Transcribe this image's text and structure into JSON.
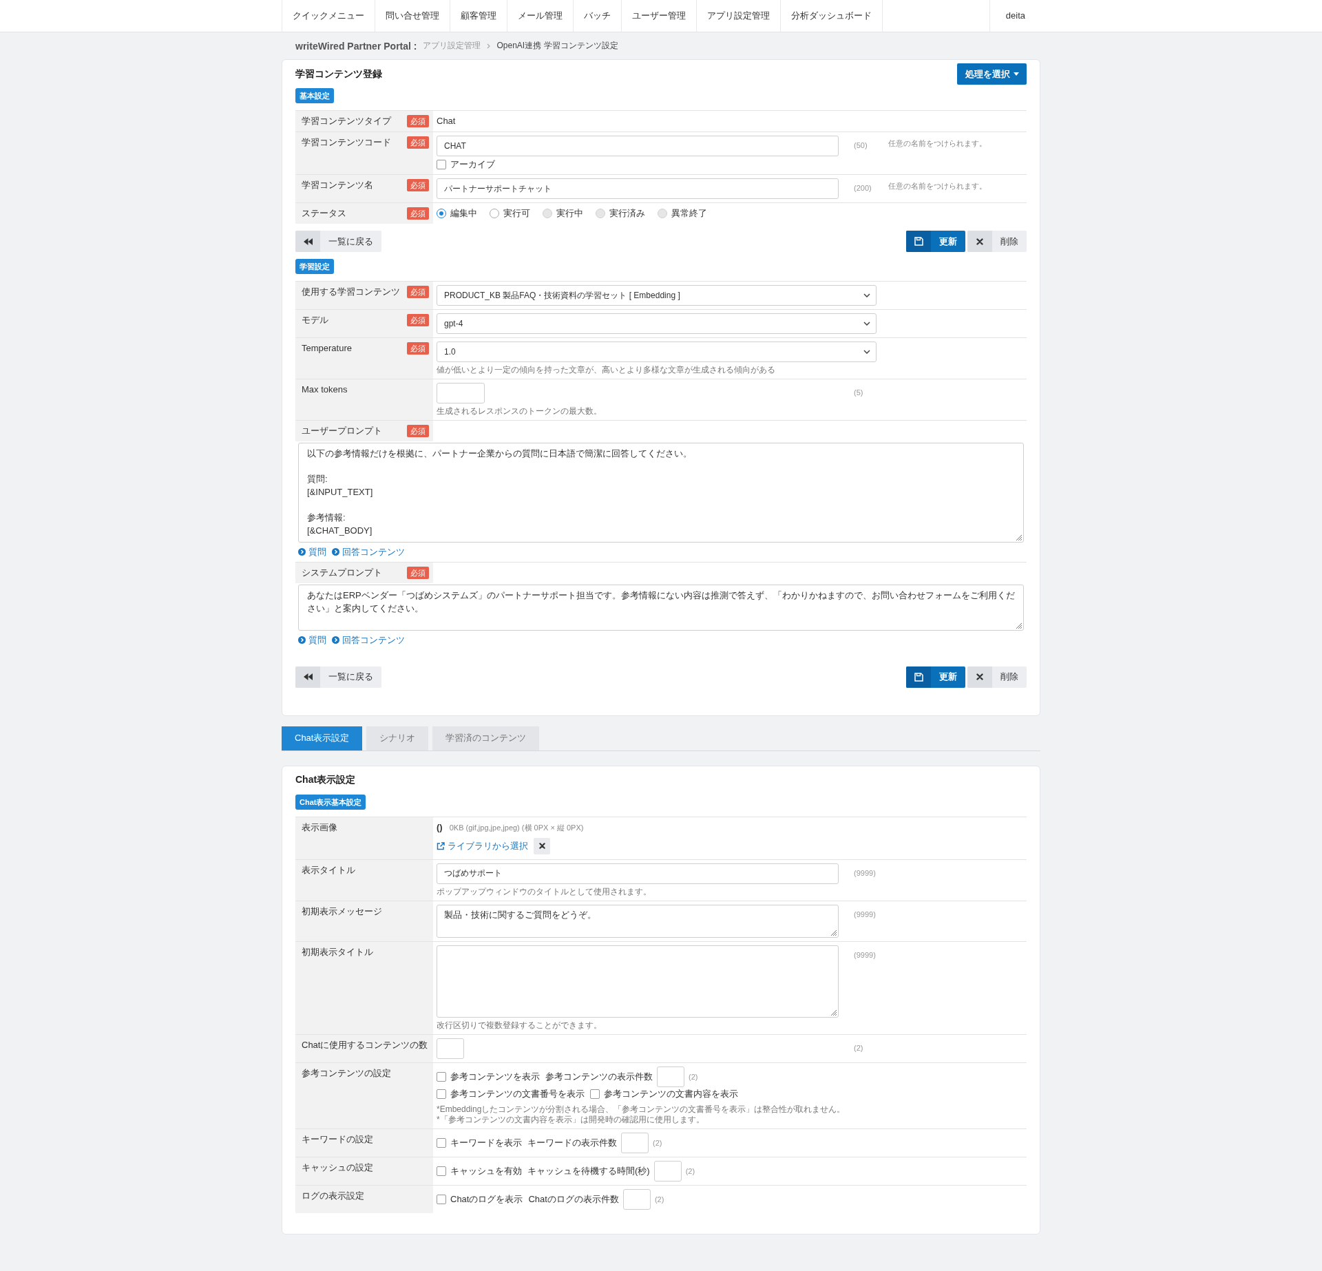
{
  "nav": {
    "items": [
      "クイックメニュー",
      "問い合せ管理",
      "顧客管理",
      "メール管理",
      "バッチ",
      "ユーザー管理",
      "アプリ設定管理",
      "分析ダッシュボード"
    ],
    "user": "deita"
  },
  "breadcrumb": {
    "site": "writeWired Partner Portal :",
    "items": [
      "アプリ設定管理",
      "OpenAI連携 学習コンテンツ設定"
    ]
  },
  "register_panel": {
    "title": "学習コンテンツ登録",
    "action_button": "処理を選択",
    "sections": [
      {
        "badge": "基本設定",
        "rows": [
          {
            "kind": "text",
            "label": "学習コンテンツタイプ",
            "required_tag": "必須",
            "value": "Chat"
          },
          {
            "kind": "input",
            "label": "学習コンテンツコード",
            "required_tag": "必須",
            "value": "CHAT",
            "count": "(50)",
            "side_note": "任意の名前をつけられます。",
            "checkbox": {
              "label": "アーカイブ",
              "checked": false
            }
          },
          {
            "kind": "input",
            "label": "学習コンテンツ名",
            "required_tag": "必須",
            "value": "パートナーサポートチャット",
            "count": "(200)",
            "side_note": "任意の名前をつけられます。"
          },
          {
            "kind": "radio",
            "label": "ステータス",
            "required_tag": "必須",
            "options": [
              {
                "label": "編集中",
                "selected": true,
                "disabled": false
              },
              {
                "label": "実行可",
                "selected": false,
                "disabled": false
              },
              {
                "label": "実行中",
                "selected": false,
                "disabled": true
              },
              {
                "label": "実行済み",
                "selected": false,
                "disabled": true
              },
              {
                "label": "異常終了",
                "selected": false,
                "disabled": true
              }
            ]
          }
        ],
        "buttons": {
          "back": "一覧に戻る",
          "update": "更新",
          "delete": "削除"
        }
      },
      {
        "badge": "学習設定",
        "rows": [
          {
            "kind": "select",
            "label": "使用する学習コンテンツ",
            "required_tag": "必須",
            "value": "PRODUCT_KB 製品FAQ・技術資料の学習セット [ Embedding ]"
          },
          {
            "kind": "select",
            "label": "モデル",
            "required_tag": "必須",
            "value": "gpt-4"
          },
          {
            "kind": "select",
            "label": "Temperature",
            "required_tag": "必須",
            "value": "1.0",
            "hint": "値が低いとより一定の傾向を持った文章が、高いとより多様な文章が生成される傾向がある"
          },
          {
            "kind": "number",
            "label": "Max tokens",
            "count": "(5)",
            "hint": "生成されるレスポンスのトークンの最大数。"
          },
          {
            "kind": "prompt",
            "label": "ユーザープロンプト",
            "required_tag": "必須",
            "paragraphs": [
              {
                "lines": [
                  "以下の参考情報だけを根拠に、パートナー企業からの質問に日本語で簡潔に回答してください。"
                ]
              },
              {
                "lines": [
                  "質問:",
                  "[&INPUT_TEXT]"
                ]
              },
              {
                "lines": [
                  "参考情報:",
                  "[&CHAT_BODY]"
                ]
              }
            ],
            "links": [
              "質問",
              "回答コンテンツ"
            ]
          },
          {
            "kind": "prompt",
            "label": "システムプロンプト",
            "required_tag": "必須",
            "paragraphs": [
              {
                "lines": [
                  "あなたはERPベンダー「つばめシステムズ」のパートナーサポート担当です。参考情報にない内容は推測で答えず、「わかりかねますので、お問い合わせフォームをご利用ください」と案内してください。"
                ]
              }
            ],
            "links": [
              "質問",
              "回答コンテンツ"
            ]
          }
        ],
        "buttons": {
          "back": "一覧に戻る",
          "update": "更新",
          "delete": "削除"
        }
      }
    ]
  },
  "tabs": [
    {
      "label": "Chat表示設定",
      "selected": true
    },
    {
      "label": "シナリオ",
      "selected": false
    },
    {
      "label": "学習済のコンテンツ",
      "selected": false
    }
  ],
  "chat_panel": {
    "title": "Chat表示設定",
    "sections": [
      {
        "badge": "Chat表示基本設定",
        "rows": [
          {
            "kind": "image",
            "label": "表示画像",
            "value": "()",
            "info": "0KB (gif,jpg,jpe,jpeg) (横 0PX × 縦 0PX)",
            "link": "ライブラリから選択"
          },
          {
            "kind": "input",
            "label": "表示タイトル",
            "value": "つばめサポート",
            "count": "(9999)",
            "hint": "ポップアップウィンドウのタイトルとして使用されます。"
          },
          {
            "kind": "textarea",
            "label": "初期表示メッセージ",
            "value": "製品・技術に関するご質問をどうぞ。",
            "count": "(9999)"
          },
          {
            "kind": "list",
            "label": "初期表示タイトル",
            "count": "(9999)",
            "hint": "改行区切りで複数登録することができます。"
          },
          {
            "kind": "digits",
            "label": "Chatに使用するコンテンツの数",
            "count": "(2)"
          },
          {
            "kind": "options",
            "label": "参考コンテンツの設定",
            "lines": [
              {
                "items": [
                  {
                    "kind": "checkbox",
                    "label": "参考コンテンツを表示",
                    "checked": false
                  },
                  {
                    "kind": "number",
                    "label": "参考コンテンツの表示件数",
                    "count": "(2)"
                  }
                ]
              },
              {
                "items": [
                  {
                    "kind": "checkbox",
                    "label": "参考コンテンツの文書番号を表示",
                    "checked": false
                  },
                  {
                    "kind": "checkbox",
                    "label": "参考コンテンツの文書内容を表示",
                    "checked": false
                  }
                ]
              }
            ],
            "notes": [
              "*Embeddingしたコンテンツが分割される場合、「参考コンテンツの文書番号を表示」は整合性が取れません。",
              "*「参考コンテンツの文書内容を表示」は開発時の確認用に使用します。"
            ]
          },
          {
            "kind": "options",
            "label": "キーワードの設定",
            "lines": [
              {
                "items": [
                  {
                    "kind": "checkbox",
                    "label": "キーワードを表示",
                    "checked": false
                  },
                  {
                    "kind": "number",
                    "label": "キーワードの表示件数",
                    "count": "(2)"
                  }
                ]
              }
            ]
          },
          {
            "kind": "options",
            "label": "キャッシュの設定",
            "lines": [
              {
                "items": [
                  {
                    "kind": "checkbox",
                    "label": "キャッシュを有効",
                    "checked": false
                  },
                  {
                    "kind": "number",
                    "label": "キャッシュを待機する時間(秒)",
                    "count": "(2)"
                  }
                ]
              }
            ]
          },
          {
            "kind": "options",
            "label": "ログの表示設定",
            "lines": [
              {
                "items": [
                  {
                    "kind": "checkbox",
                    "label": "Chatのログを表示",
                    "checked": false
                  },
                  {
                    "kind": "number",
                    "label": "Chatのログの表示件数",
                    "count": "(2)"
                  }
                ]
              }
            ]
          }
        ]
      }
    ]
  }
}
